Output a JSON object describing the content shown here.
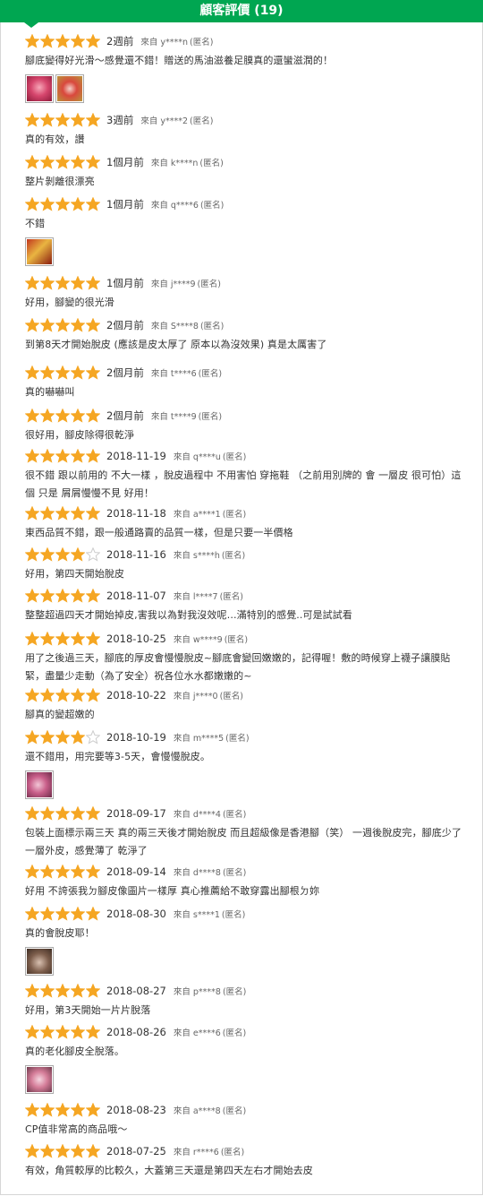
{
  "header": {
    "title": "顧客評價 (19)"
  },
  "colors": {
    "brand": "#00a651",
    "star_on": "#f5a623",
    "star_off": "#cccccc"
  },
  "reviews": [
    {
      "rating": 5,
      "date": "2週前",
      "from": "來自 y****n",
      "anon": "(匿名)",
      "text": "腳底變得好光滑～感覺還不錯！贈送的馬油滋養足膜真的還蠻滋潤的！",
      "photos": [
        "pink-photo",
        "red-photo"
      ]
    },
    {
      "rating": 5,
      "date": "3週前",
      "from": "來自 y****2",
      "anon": "(匿名)",
      "text": "真的有效，讚",
      "photos": []
    },
    {
      "rating": 5,
      "date": "1個月前",
      "from": "來自 k****n",
      "anon": "(匿名)",
      "text": "整片剝離很漂亮",
      "photos": []
    },
    {
      "rating": 5,
      "date": "1個月前",
      "from": "來自 q****6",
      "anon": "(匿名)",
      "text": "不錯",
      "photos": [
        "product-photo"
      ]
    },
    {
      "rating": 5,
      "date": "1個月前",
      "from": "來自 j****9",
      "anon": "(匿名)",
      "text": "好用，腳變的很光滑",
      "photos": []
    },
    {
      "rating": 5,
      "date": "2個月前",
      "from": "來自 S****8",
      "anon": "(匿名)",
      "text": "到第8天才開始脫皮 (應該是皮太厚了 原本以為沒效果) 真是太厲害了",
      "photos": []
    },
    {
      "rating": 5,
      "date": "2個月前",
      "from": "來自 t****6",
      "anon": "(匿名)",
      "text": "真的嚇嚇叫",
      "photos": []
    },
    {
      "rating": 5,
      "date": "2個月前",
      "from": "來自 t****9",
      "anon": "(匿名)",
      "text": "很好用，腳皮除得很乾淨",
      "photos": []
    },
    {
      "rating": 5,
      "date": "2018-11-19",
      "from": "來自 q****u",
      "anon": "(匿名)",
      "text": "很不錯 跟以前用的 不大一樣 ，脫皮過程中 不用害怕 穿拖鞋 （之前用別牌的 會 一層皮 很可怕）這個 只是 屑屑慢慢不見 好用！",
      "photos": []
    },
    {
      "rating": 5,
      "date": "2018-11-18",
      "from": "來自 a****1",
      "anon": "(匿名)",
      "text": "東西品質不錯，跟一般通路賣的品質一樣，但是只要一半價格",
      "photos": []
    },
    {
      "rating": 4,
      "date": "2018-11-16",
      "from": "來自 s****h",
      "anon": "(匿名)",
      "text": "好用，第四天開始脫皮",
      "photos": []
    },
    {
      "rating": 5,
      "date": "2018-11-07",
      "from": "來自 l****7",
      "anon": "(匿名)",
      "text": "整整超過四天才開始掉皮,害我以為對我沒效呢…滿特別的感覺..可是試試看",
      "photos": []
    },
    {
      "rating": 5,
      "date": "2018-10-25",
      "from": "來自 w****9",
      "anon": "(匿名)",
      "text": "用了之後過三天，腳底的厚皮會慢慢脫皮~腳底會變回嫩嫩的，記得喔！敷的時候穿上襪子讓膜貼緊，盡量少走動（為了安全）祝各位水水都嫩嫩的~",
      "photos": []
    },
    {
      "rating": 5,
      "date": "2018-10-22",
      "from": "來自 j****0",
      "anon": "(匿名)",
      "text": "腳真的變超嫩的",
      "photos": []
    },
    {
      "rating": 4,
      "date": "2018-10-19",
      "from": "來自 m****5",
      "anon": "(匿名)",
      "text": "還不錯用，用完要等3-5天，會慢慢脫皮。",
      "photos": [
        "feet-photo"
      ]
    },
    {
      "rating": 5,
      "date": "2018-09-17",
      "from": "來自 d****4",
      "anon": "(匿名)",
      "text": "包裝上面標示兩三天 真的兩三天後才開始脫皮 而且超級像是香港腳（笑） 一週後脫皮完，腳底少了一層外皮，感覺薄了 乾淨了",
      "photos": []
    },
    {
      "rating": 5,
      "date": "2018-09-14",
      "from": "來自 d****8",
      "anon": "(匿名)",
      "text": "好用 不誇張我ㄉ腳皮像圖片一樣厚 真心推薦給不敢穿露出腳根ㄉ妳",
      "photos": []
    },
    {
      "rating": 5,
      "date": "2018-08-30",
      "from": "來自 s****1",
      "anon": "(匿名)",
      "text": "真的會脫皮耶！",
      "photos": [
        "foot-photo"
      ]
    },
    {
      "rating": 5,
      "date": "2018-08-27",
      "from": "來自 p****8",
      "anon": "(匿名)",
      "text": "好用，第3天開始一片片脫落",
      "photos": []
    },
    {
      "rating": 5,
      "date": "2018-08-26",
      "from": "來自 e****6",
      "anon": "(匿名)",
      "text": "真的老化腳皮全脫落。",
      "photos": [
        "pink-product-photo"
      ]
    },
    {
      "rating": 5,
      "date": "2018-08-23",
      "from": "來自 a****8",
      "anon": "(匿名)",
      "text": "CP值非常高的商品哦～",
      "photos": []
    },
    {
      "rating": 5,
      "date": "2018-07-25",
      "from": "來自 r****6",
      "anon": "(匿名)",
      "text": "有效，角質較厚的比較久，大蓋第三天還是第四天左右才開始去皮",
      "photos": []
    }
  ]
}
